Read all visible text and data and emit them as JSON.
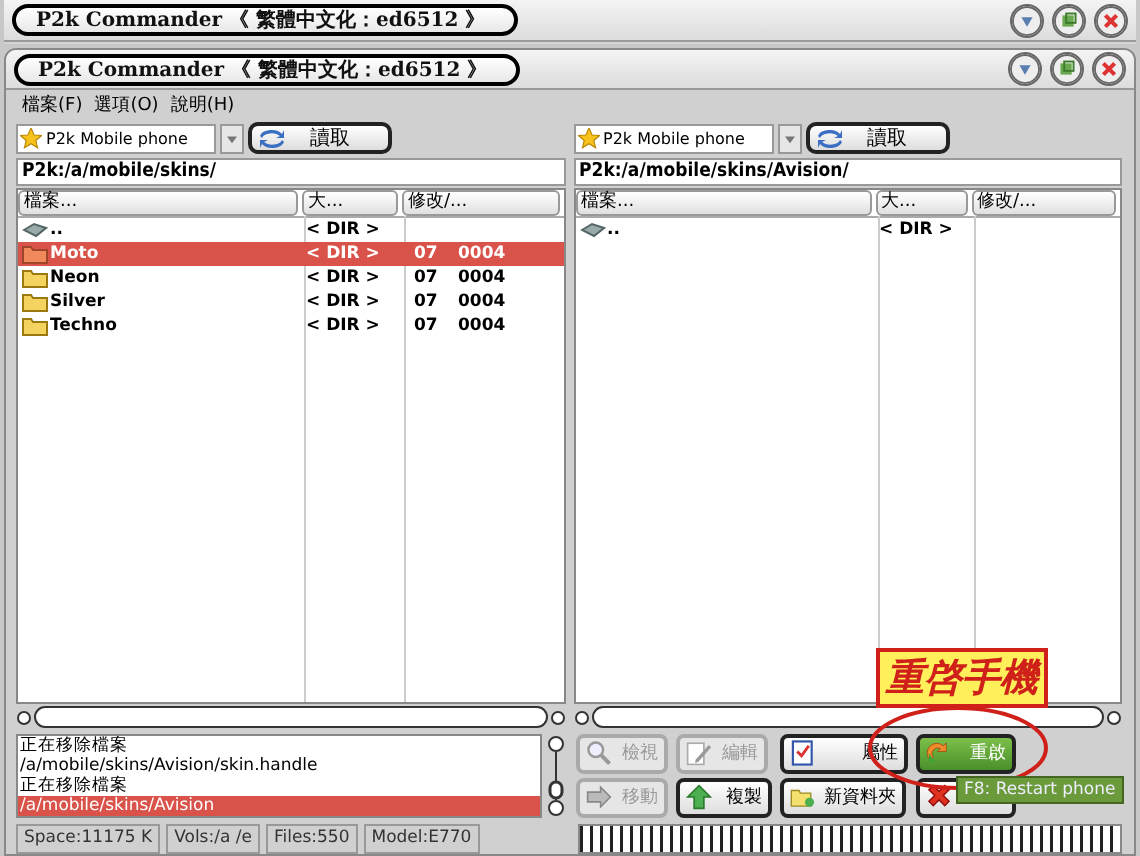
{
  "background_window": {
    "title": "P2k Commander 《 繁體中文化：ed6512 》"
  },
  "window": {
    "title": "P2k Commander 《 繁體中文化：ed6512 》"
  },
  "menu": [
    {
      "label": "檔案(F)"
    },
    {
      "label": "選項(O)"
    },
    {
      "label": "說明(H)"
    }
  ],
  "panels": [
    {
      "device": "P2k Mobile phone",
      "read_button": "讀取",
      "path": "P2k:/a/mobile/skins/",
      "columns": [
        "檔案...",
        "大...",
        "修改/..."
      ],
      "rows": [
        {
          "kind": "up",
          "name": "..",
          "size": "< DIR >",
          "selected": false
        },
        {
          "kind": "folder",
          "name": "Moto",
          "size": "< DIR >",
          "date": "07",
          "time": "0004",
          "selected": true
        },
        {
          "kind": "folder",
          "name": "Neon",
          "size": "< DIR >",
          "date": "07",
          "time": "0004",
          "selected": false
        },
        {
          "kind": "folder",
          "name": "Silver",
          "size": "< DIR >",
          "date": "07",
          "time": "0004",
          "selected": false
        },
        {
          "kind": "folder",
          "name": "Techno",
          "size": "< DIR >",
          "date": "07",
          "time": "0004",
          "selected": false
        }
      ]
    },
    {
      "device": "P2k Mobile phone",
      "read_button": "讀取",
      "path": "P2k:/a/mobile/skins/Avision/",
      "columns": [
        "檔案...",
        "大...",
        "修改/..."
      ],
      "rows": [
        {
          "kind": "up",
          "name": "..",
          "size": "< DIR >",
          "selected": false
        }
      ]
    }
  ],
  "log": [
    {
      "text": "正在移除檔案",
      "selected": false
    },
    {
      "text": "/a/mobile/skins/Avision/skin.handle",
      "selected": false
    },
    {
      "text": "正在移除檔案",
      "selected": false
    },
    {
      "text": "/a/mobile/skins/Avision",
      "selected": true
    }
  ],
  "actions": [
    {
      "kind": "view",
      "label": "檢視",
      "disabled": true
    },
    {
      "kind": "edit",
      "label": "編輯",
      "disabled": true
    },
    {
      "kind": "properties",
      "label": "屬性",
      "disabled": false
    },
    {
      "kind": "restart",
      "label": "重啟",
      "disabled": false
    },
    {
      "kind": "move",
      "label": "移動",
      "disabled": true
    },
    {
      "kind": "copy",
      "label": "複製",
      "disabled": false
    },
    {
      "kind": "new-folder",
      "label": "新資料夾",
      "disabled": false
    },
    {
      "kind": "delete",
      "disabled": false
    }
  ],
  "annotation": {
    "text": "重啓手機"
  },
  "tooltip": {
    "text": "F8: Restart phone"
  },
  "status_bar": [
    "Space:11175 K",
    "Vols:/a /e",
    "Files:550",
    "Model:E770"
  ],
  "progress": {
    "level": 1
  }
}
